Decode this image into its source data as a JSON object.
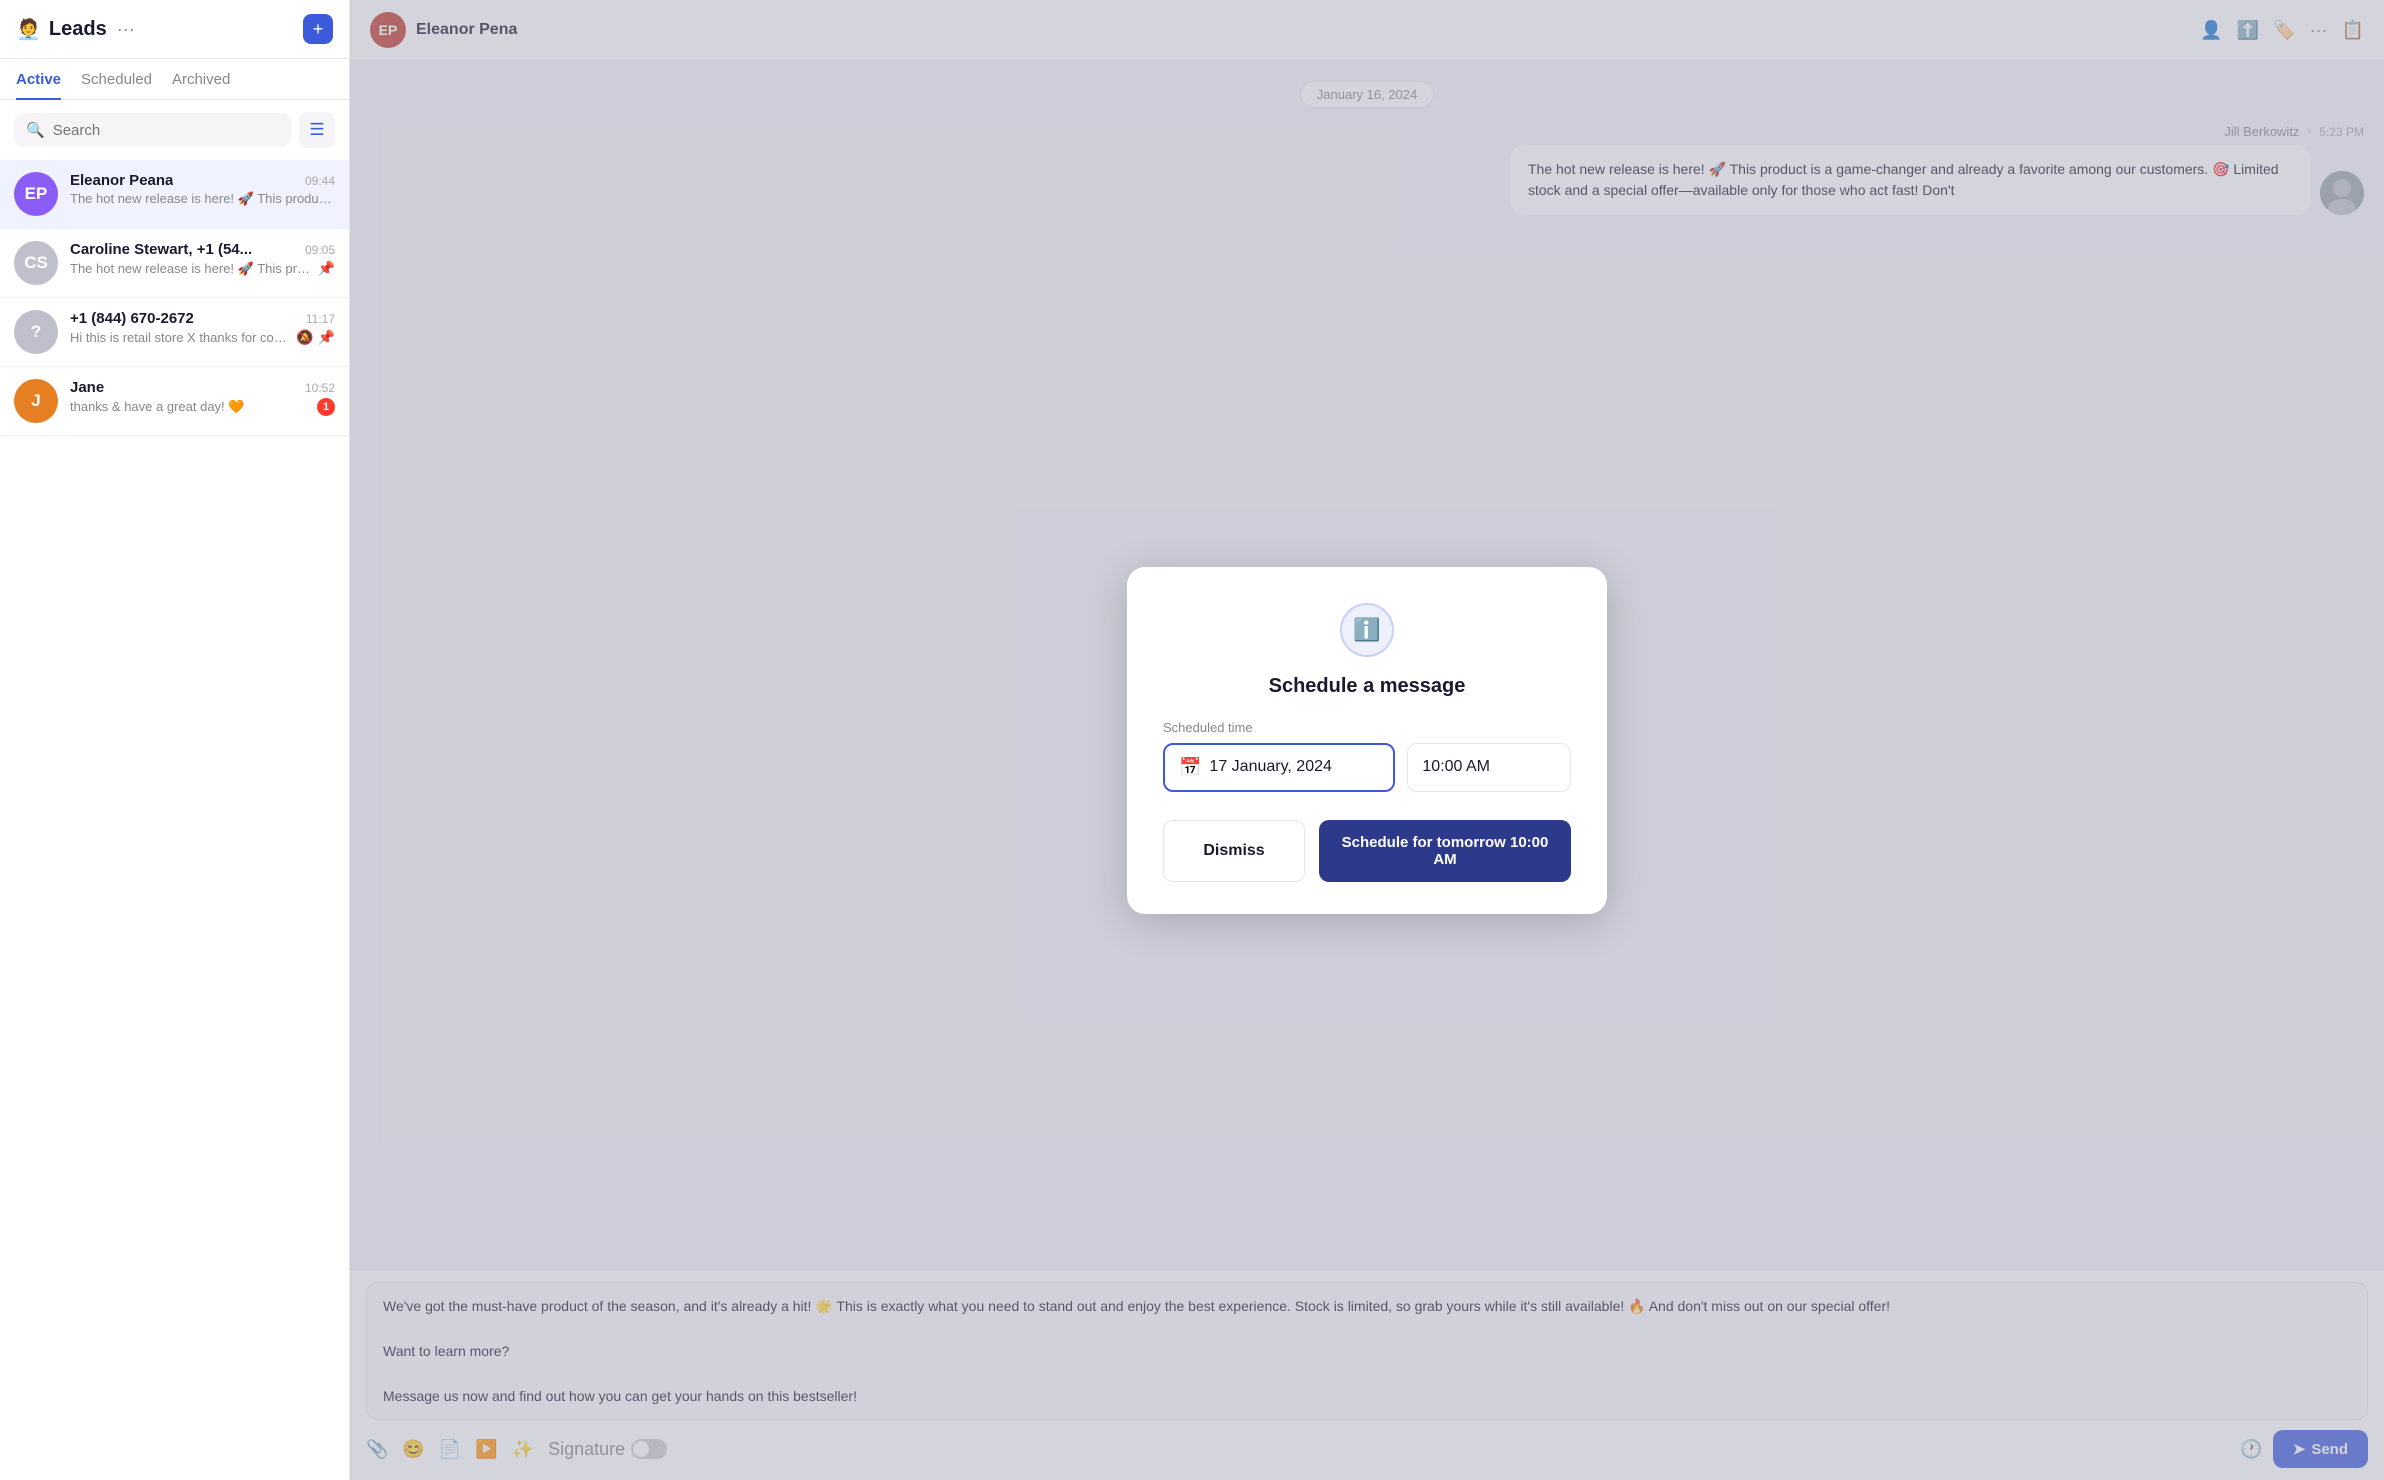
{
  "sidebar": {
    "title": "Leads",
    "title_emoji": "🧑‍💼",
    "tabs": [
      {
        "label": "Active",
        "active": true
      },
      {
        "label": "Scheduled",
        "active": false
      },
      {
        "label": "Archived",
        "active": false
      }
    ],
    "search_placeholder": "Search",
    "contacts": [
      {
        "name": "Eleanor Peana",
        "time": "09:44",
        "preview": "The hot new release is here! 🚀 This product is a game-changer and alr...",
        "avatar_color": "#8b5cf6",
        "initials": "EP",
        "selected": true,
        "badge": null,
        "muted": false,
        "pinned": false
      },
      {
        "name": "Caroline Stewart, +1 (54...",
        "time": "09:05",
        "preview": "The hot new release is here! 🚀 This product is a game-chang...",
        "avatar_color": "#d1d5db",
        "initials": "CS",
        "selected": false,
        "badge": null,
        "muted": false,
        "pinned": true
      },
      {
        "name": "+1 (844) 670-2672",
        "time": "11:17",
        "preview": "Hi this is retail store X thanks for contacting us. Stdrd rates...",
        "avatar_color": "#d1d5db",
        "initials": "?",
        "selected": false,
        "badge": null,
        "muted": true,
        "pinned": true
      },
      {
        "name": "Jane",
        "time": "10:52",
        "preview": "thanks & have a great day! 🧡",
        "avatar_color": "#e67e22",
        "initials": "J",
        "selected": false,
        "badge": 1,
        "muted": false,
        "pinned": false
      }
    ]
  },
  "header": {
    "contact_name": "Eleanor Pena",
    "icons": [
      "person-add-icon",
      "export-icon",
      "tag-icon",
      "more-icon",
      "note-icon"
    ]
  },
  "chat": {
    "date": "January 16, 2024",
    "messages": [
      {
        "sender": "Jill Berkowitz",
        "time": "5:23 PM",
        "text": "The hot new release is here! 🚀 This product is a game-changer and already a favorite among our customers. 🎯 Limited stock and a special offer—available only for those who act fast! Don't"
      }
    ]
  },
  "compose": {
    "text_line1": "We've got the must-have product of the season, and it's already a hit! 🌟 This is exactly what you need to stand out and enjoy the best experience. Stock is limited, so grab yours while it's still available! 🔥 And don't miss out on our special offer!",
    "text_line2": "Want to learn more?",
    "text_line3": "Message us now and find out how you can get your hands on this bestseller!",
    "signature_label": "Signature",
    "send_label": "Send",
    "tools": [
      "paperclip-icon",
      "emoji-icon",
      "template-icon",
      "media-icon",
      "magic-icon"
    ]
  },
  "modal": {
    "title": "Schedule a message",
    "label": "Scheduled time",
    "date_value": "17 January, 2024",
    "time_value": "10:00 AM",
    "dismiss_label": "Dismiss",
    "schedule_label": "Schedule for tomorrow 10:00 AM"
  }
}
